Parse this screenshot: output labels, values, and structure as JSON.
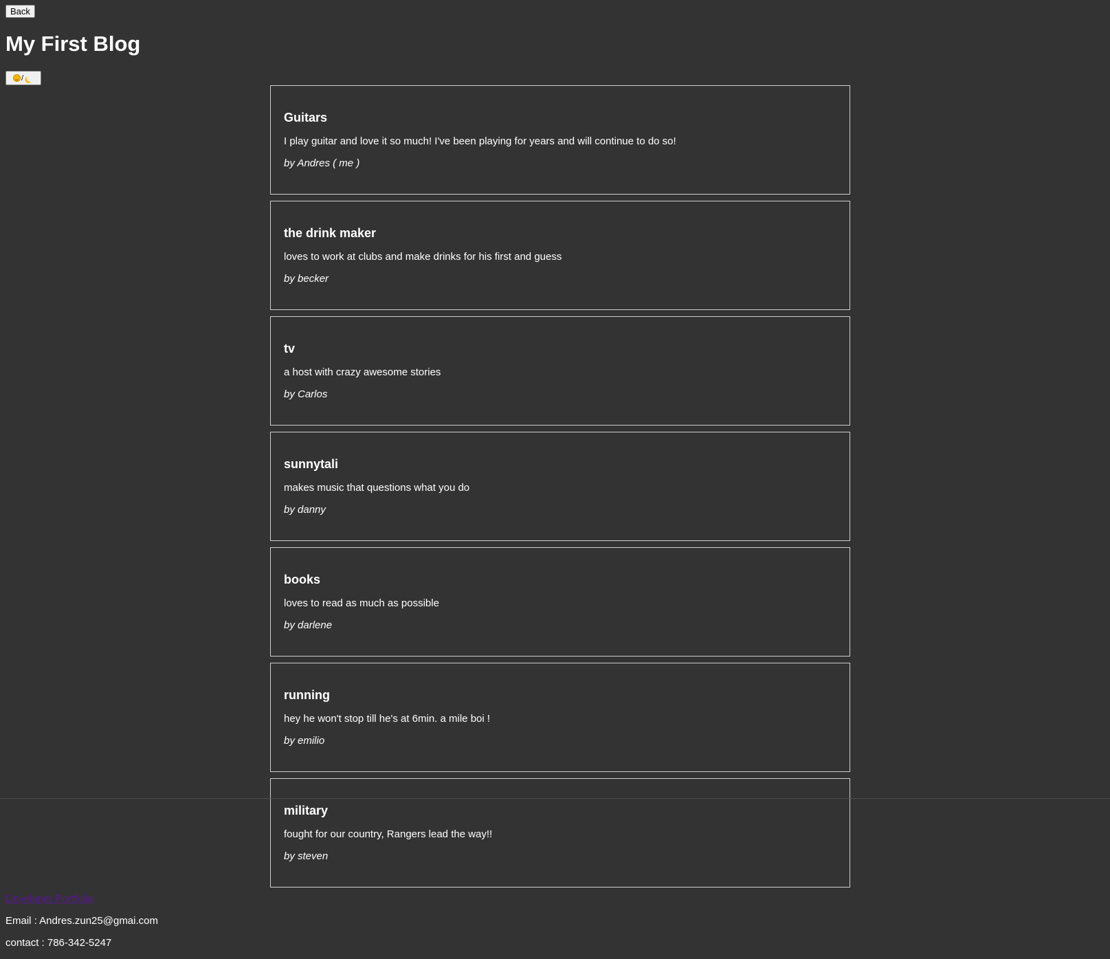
{
  "header": {
    "back_label": "Back",
    "title": "My First Blog",
    "theme_toggle_separator": "/",
    "theme_toggle_icons": [
      "sun-icon",
      "moon-icon"
    ]
  },
  "posts": [
    {
      "title": "Guitars",
      "body": "I play guitar and love it so much! I've been playing for years and will continue to do so!",
      "author": "by Andres ( me )"
    },
    {
      "title": "the drink maker",
      "body": "loves to work at clubs and make drinks for his first and guess",
      "author": "by becker"
    },
    {
      "title": "tv",
      "body": "a host with crazy awesome stories",
      "author": "by Carlos"
    },
    {
      "title": "sunnytali",
      "body": "makes music that questions what you do",
      "author": "by danny"
    },
    {
      "title": "books",
      "body": "loves to read as much as possible",
      "author": "by darlene"
    },
    {
      "title": "running",
      "body": "hey he won't stop till he's at 6min. a mile boi !",
      "author": "by emilio"
    },
    {
      "title": "military",
      "body": "fought for our country, Rangers lead the way!!",
      "author": "by steven"
    }
  ],
  "footer": {
    "portfolio_link": "Developer Portfolio",
    "email": "Email : Andres.zun25@gmai.com",
    "contact": "contact : 786-342-5247"
  },
  "colors": {
    "background": "#333333",
    "text": "#ffffff",
    "border": "#cfcfcf",
    "link_visited": "#551a8b"
  }
}
